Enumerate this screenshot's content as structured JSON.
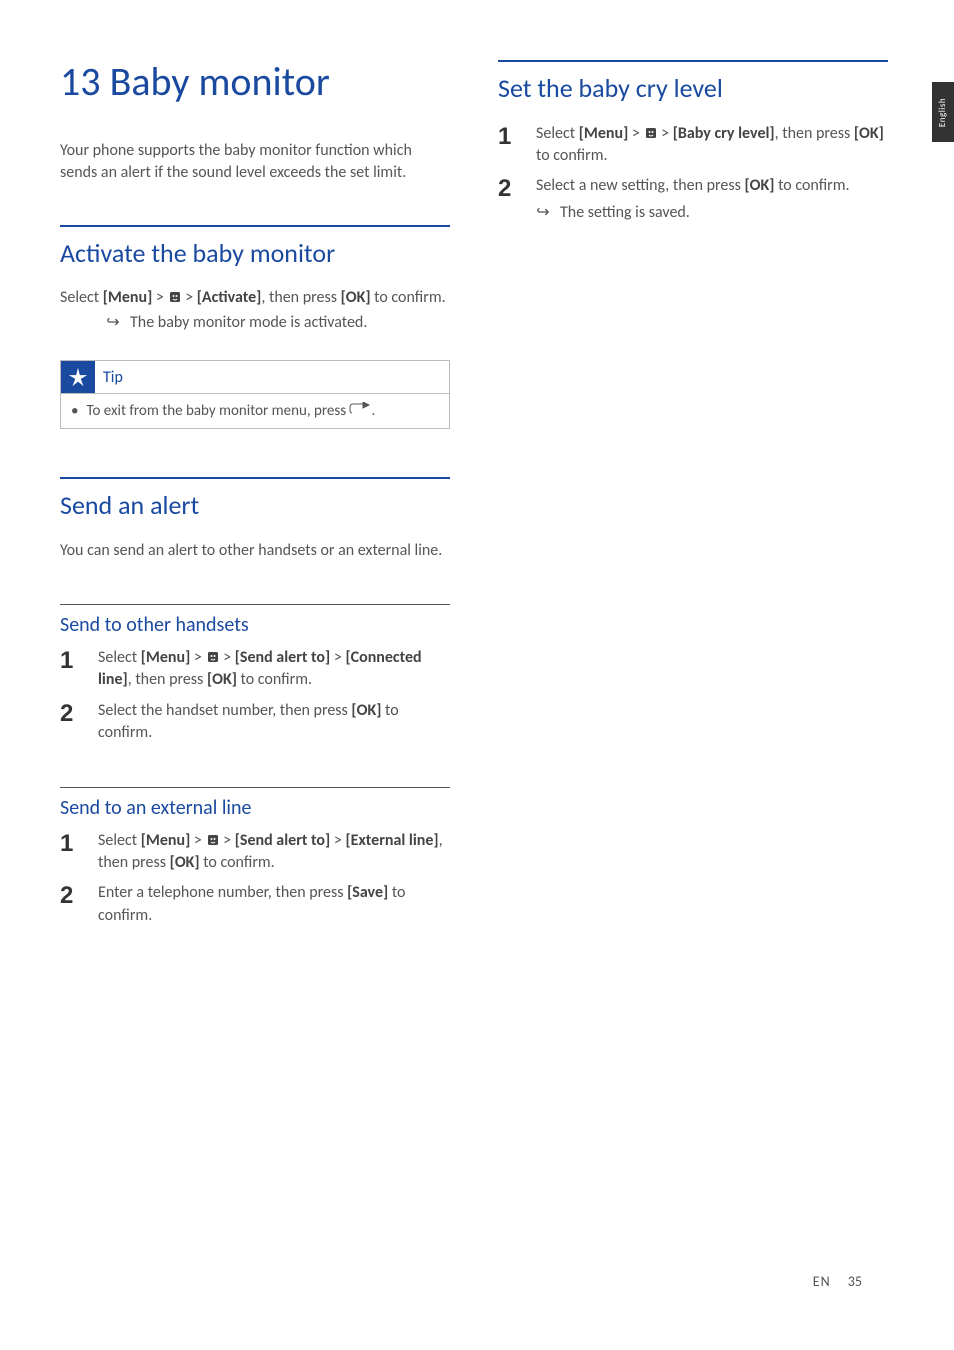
{
  "lang_tab": "English",
  "chapter": {
    "title": "13 Baby monitor"
  },
  "intro": "Your phone supports the baby monitor function which sends an alert if the sound level exceeds the set limit.",
  "activate": {
    "heading": "Activate the baby monitor",
    "line_pre": "Select ",
    "menu": "[Menu]",
    "gt": " > ",
    "activate": "[Activate]",
    "line_mid": ", then press ",
    "ok": "[OK]",
    "line_post": " to confirm.",
    "result": "The baby monitor mode is activated."
  },
  "tip": {
    "label": "Tip",
    "text_pre": "To exit from the baby monitor menu, press ",
    "text_post": "."
  },
  "send_alert": {
    "heading": "Send an alert",
    "intro": "You can send an alert to other handsets or an external line."
  },
  "send_handsets": {
    "heading": "Send to other handsets",
    "steps": [
      {
        "pre": "Select ",
        "menu": "[Menu]",
        "sendto": "[Send alert to]",
        "connected": "[Connected line]",
        "mid": ", then press ",
        "ok": "[OK]",
        "post": " to confirm."
      },
      {
        "pre": "Select the handset number, then press ",
        "ok": "[OK]",
        "post": " to confirm."
      }
    ]
  },
  "send_external": {
    "heading": "Send to an external line",
    "steps": [
      {
        "pre": "Select ",
        "menu": "[Menu]",
        "sendto": "[Send alert to]",
        "external": "[External line]",
        "mid": ", then press ",
        "ok": "[OK]",
        "post": " to confirm."
      },
      {
        "pre": "Enter a telephone number, then press ",
        "save": "[Save]",
        "post": " to confirm."
      }
    ]
  },
  "set_cry": {
    "heading": "Set the baby cry level",
    "steps": [
      {
        "pre": "Select ",
        "menu": "[Menu]",
        "cry": "[Baby cry level]",
        "mid": ", then press ",
        "ok": "[OK]",
        "post": " to confirm."
      },
      {
        "pre": "Select a new setting, then press ",
        "ok": "[OK]",
        "post": " to confirm.",
        "result": "The setting is saved."
      }
    ]
  },
  "footer": {
    "lang": "EN",
    "page": "35"
  }
}
